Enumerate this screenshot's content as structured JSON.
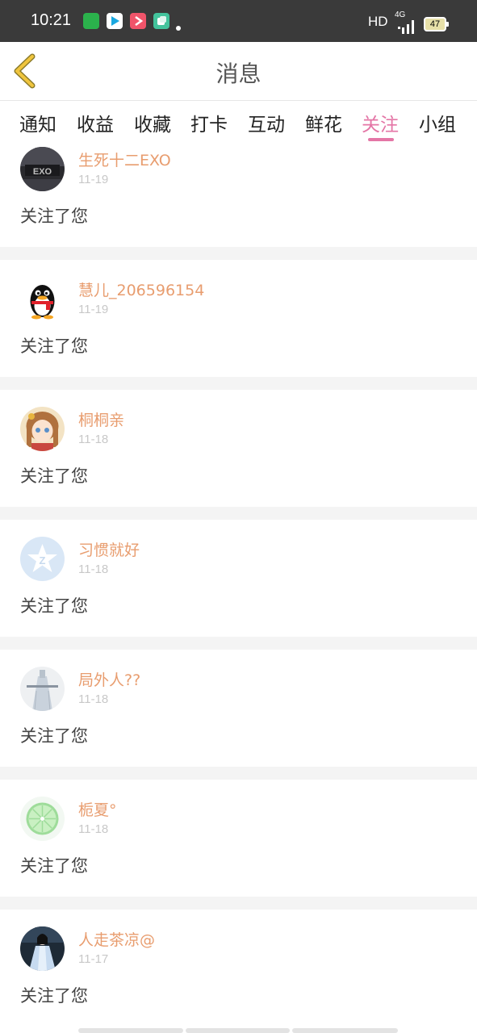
{
  "status_bar": {
    "time": "10:21",
    "network": "HD",
    "cell": "4G",
    "battery": "47",
    "app_icon_colors": [
      "#2bb24c",
      "#1aa8e0",
      "#f0546a",
      "#43c39c"
    ]
  },
  "header": {
    "title": "消息",
    "back_icon": "chevron-left-icon",
    "back_icon_color": "#e8b93c"
  },
  "tabs": [
    {
      "label": "通知"
    },
    {
      "label": "收益"
    },
    {
      "label": "收藏"
    },
    {
      "label": "打卡"
    },
    {
      "label": "互动"
    },
    {
      "label": "鲜花"
    },
    {
      "label": "关注",
      "active": true
    },
    {
      "label": "小组"
    }
  ],
  "accent_color": "#e476a6",
  "name_color": "#e89d6f",
  "messages": [
    {
      "name": "生死十二EXO",
      "date": "11-19",
      "text": "关注了您",
      "avatar": "exo-avatar"
    },
    {
      "name": "慧儿_206596154",
      "date": "11-19",
      "text": "关注了您",
      "avatar": "penguin-avatar"
    },
    {
      "name": "桐桐亲",
      "date": "11-18",
      "text": "关注了您",
      "avatar": "anime-girl-avatar"
    },
    {
      "name": "习惯就好",
      "date": "11-18",
      "text": "关注了您",
      "avatar": "qzone-star-avatar"
    },
    {
      "name": "局外人??",
      "date": "11-18",
      "text": "关注了您",
      "avatar": "dress-avatar"
    },
    {
      "name": "栀夏°",
      "date": "11-18",
      "text": "关注了您",
      "avatar": "lime-slice-avatar"
    },
    {
      "name": "人走茶凉@",
      "date": "11-17",
      "text": "关注了您",
      "avatar": "hanfu-avatar"
    }
  ]
}
